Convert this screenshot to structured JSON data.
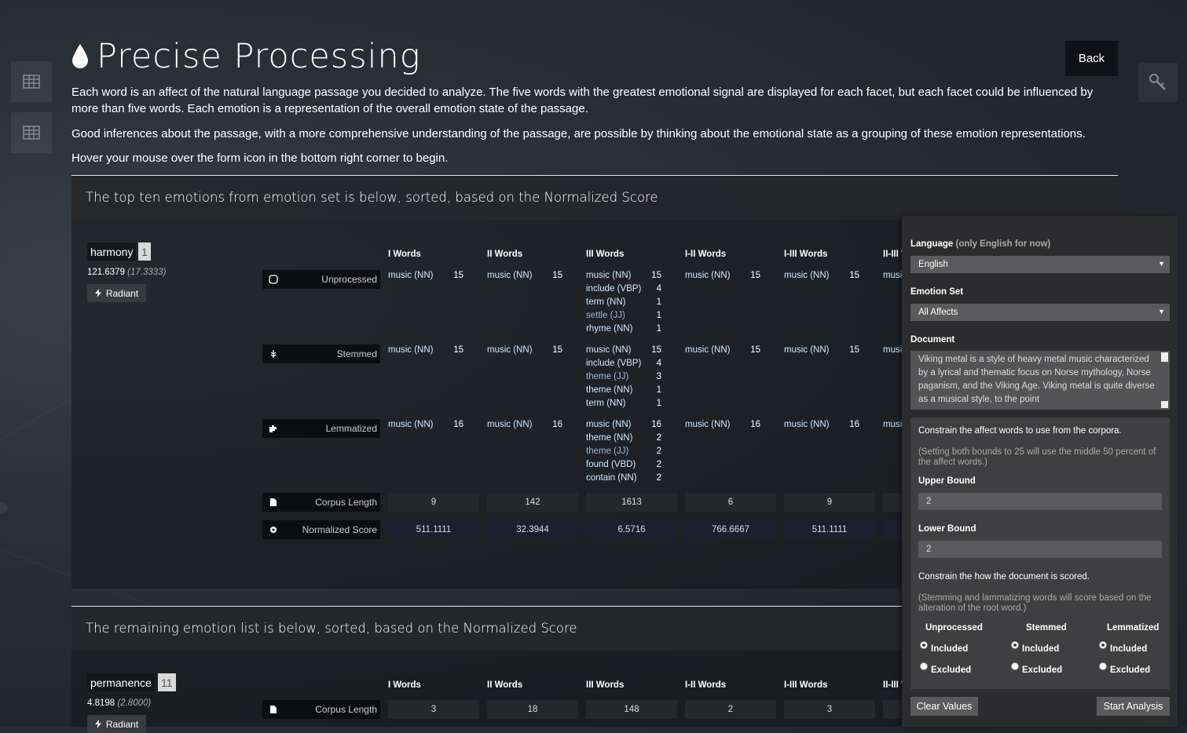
{
  "page": {
    "title": "Precise Processing",
    "back_label": "Back",
    "intro": [
      "Each word is an affect of the natural language passage you decided to analyze. The five words with the greatest emotional signal are displayed for each facet, but each facet could be influenced by more than five words. Each emotion is a representation of the overall emotion state of the passage.",
      "Good inferences about the passage, with a more comprehensive understanding of the passage, are possible by thinking about the emotional state as a grouping of these emotion representations.",
      "Hover your mouse over the form icon in the bottom right corner to begin."
    ]
  },
  "icons": {
    "title": "drop-icon",
    "side_buttons": [
      "table-icon",
      "table-icon"
    ],
    "key_button": "key-icon",
    "rows": [
      "square-icon",
      "wheat-icon",
      "puzzle-icon",
      "file-icon",
      "gear-icon"
    ],
    "radiant": "bolt-icon"
  },
  "top_section": {
    "heading": "The top ten emotions from emotion set is below, sorted, based on the Normalized Score",
    "emotion": {
      "name": "harmony",
      "rank": "1",
      "score": "121.6379",
      "score_paren": "(17.3333)",
      "radiant_label": "Radiant"
    },
    "columns": [
      "I Words",
      "II Words",
      "III Words",
      "I-II Words",
      "I-III Words",
      "II-III Words"
    ],
    "rows": [
      {
        "label": "Unprocessed",
        "cells": [
          [
            [
              "music (NN)",
              "15"
            ]
          ],
          [
            [
              "music (NN)",
              "15"
            ]
          ],
          [
            [
              "music (NN)",
              "15"
            ],
            [
              "include (VBP)",
              "4"
            ],
            [
              "term (NN)",
              "1"
            ],
            [
              "settle (JJ)",
              "1"
            ],
            [
              "rhyme (NN)",
              "1"
            ]
          ],
          [
            [
              "music (NN)",
              "15"
            ]
          ],
          [
            [
              "music (NN)",
              "15"
            ]
          ],
          [
            [
              "music (NN)",
              ""
            ]
          ]
        ]
      },
      {
        "label": "Stemmed",
        "cells": [
          [
            [
              "music (NN)",
              "15"
            ]
          ],
          [
            [
              "music (NN)",
              "15"
            ]
          ],
          [
            [
              "music (NN)",
              "15"
            ],
            [
              "include (VBP)",
              "4"
            ],
            [
              "theme (JJ)",
              "3"
            ],
            [
              "theme (NN)",
              "1"
            ],
            [
              "term (NN)",
              "1"
            ]
          ],
          [
            [
              "music (NN)",
              "15"
            ]
          ],
          [
            [
              "music (NN)",
              "15"
            ]
          ],
          [
            [
              "music (NN)",
              ""
            ]
          ]
        ]
      },
      {
        "label": "Lemmatized",
        "cells": [
          [
            [
              "music (NN)",
              "16"
            ]
          ],
          [
            [
              "music (NN)",
              "16"
            ]
          ],
          [
            [
              "music (NN)",
              "16"
            ],
            [
              "theme (NN)",
              "2"
            ],
            [
              "theme (JJ)",
              "2"
            ],
            [
              "found (VBD)",
              "2"
            ],
            [
              "contain (NN)",
              "2"
            ]
          ],
          [
            [
              "music (NN)",
              "16"
            ]
          ],
          [
            [
              "music (NN)",
              "16"
            ]
          ],
          [
            [
              "music (NN)",
              ""
            ]
          ]
        ]
      }
    ],
    "corpus_length_label": "Corpus Length",
    "corpus_length": [
      "9",
      "142",
      "1613",
      "6",
      "9",
      ""
    ],
    "normalized_label": "Normalized Score",
    "normalized": [
      "511.1111",
      "32.3944",
      "6.5716",
      "766.6667",
      "511.1111",
      ""
    ]
  },
  "remaining_section": {
    "heading": "The remaining emotion list is below, sorted, based on the Normalized Score",
    "emotion": {
      "name": "permanence",
      "rank": "11",
      "score": "4.8198",
      "score_paren": "(2.8000)",
      "radiant_label": "Radiant"
    },
    "columns": [
      "I Words",
      "II Words",
      "III Words",
      "I-II Words",
      "I-III Words",
      "II-III Words"
    ],
    "corpus_length_label": "Corpus Length",
    "corpus_length": [
      "3",
      "18",
      "148",
      "2",
      "3",
      ""
    ]
  },
  "form": {
    "language_label": "Language",
    "language_note": "(only English for now)",
    "language_value": "English",
    "emotion_set_label": "Emotion Set",
    "emotion_set_value": "All Affects",
    "document_label": "Document",
    "document_text": "Viking metal is a style of heavy metal music characterized by a lyrical and thematic focus on Norse mythology, Norse paganism, and the Viking Age. Viking metal is quite diverse as a musical style, to the point",
    "constrain_affect": "Constrain the affect words to use from the corpora.",
    "constrain_affect_note": "(Setting both bounds to 25 will use the middle 50 percent of the affect words.)",
    "upper_bound_label": "Upper Bound",
    "upper_bound_value": "2",
    "lower_bound_label": "Lower Bound",
    "lower_bound_value": "2",
    "constrain_scored": "Constrain the how the document is scored.",
    "constrain_scored_note": "(Stemming and lammatizing words will score based on the alteration of the root word.)",
    "radio_groups": [
      {
        "heading": "Unprocessed",
        "included": "Included",
        "excluded": "Excluded"
      },
      {
        "heading": "Stemmed",
        "included": "Included",
        "excluded": "Excluded"
      },
      {
        "heading": "Lemmatized",
        "included": "Included",
        "excluded": "Excluded"
      }
    ],
    "clear_label": "Clear Values",
    "start_label": "Start Analysis"
  }
}
